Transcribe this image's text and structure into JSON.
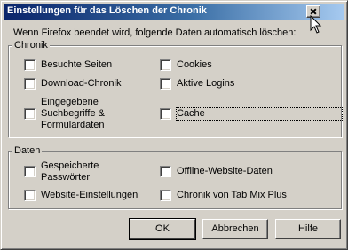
{
  "window": {
    "title": "Einstellungen für das Löschen der Chronik"
  },
  "intro_text": "Wenn Firefox beendet wird, folgende Daten automatisch löschen:",
  "chronik": {
    "legend": "Chronik",
    "items": [
      {
        "label": "Besuchte Seiten",
        "checked": false
      },
      {
        "label": "Cookies",
        "checked": false
      },
      {
        "label": "Download-Chronik",
        "checked": false
      },
      {
        "label": "Aktive Logins",
        "checked": false
      },
      {
        "label": "Eingegebene Suchbegriffe & Formulardaten",
        "checked": false
      },
      {
        "label": "Cache",
        "checked": false
      }
    ]
  },
  "daten": {
    "legend": "Daten",
    "items": [
      {
        "label": "Gespeicherte Passwörter",
        "checked": false
      },
      {
        "label": "Offline-Website-Daten",
        "checked": false
      },
      {
        "label": "Website-Einstellungen",
        "checked": false
      },
      {
        "label": "Chronik von Tab Mix Plus",
        "checked": false
      }
    ]
  },
  "buttons": {
    "ok": "OK",
    "cancel": "Abbrechen",
    "help": "Hilfe"
  }
}
